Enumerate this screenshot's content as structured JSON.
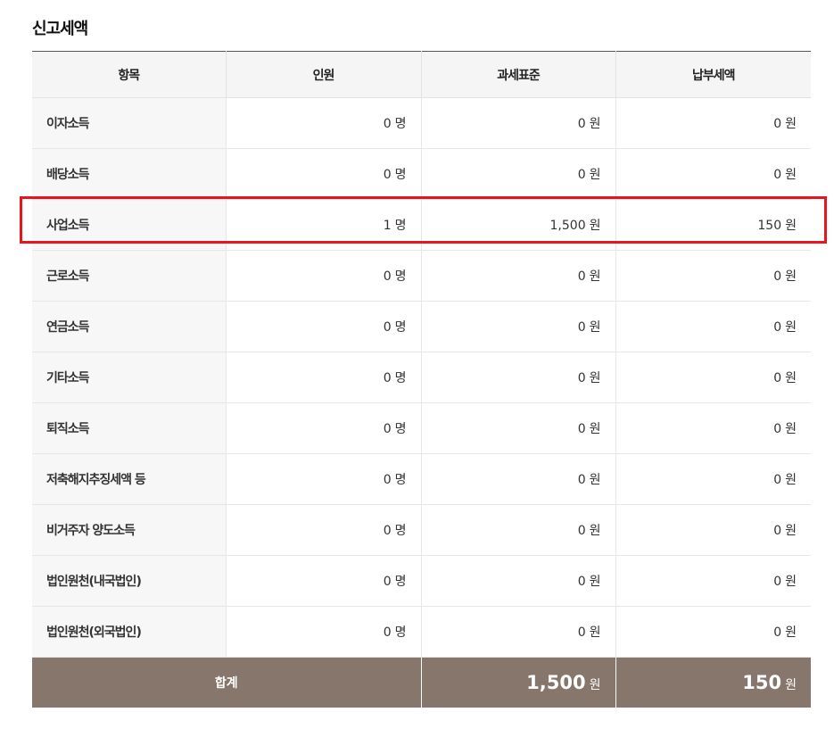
{
  "section_title": "신고세액",
  "headers": {
    "item": "항목",
    "people": "인원",
    "tax_base": "과세표준",
    "tax_paid": "납부세액"
  },
  "rows": [
    {
      "item": "이자소득",
      "people": "0",
      "people_unit": "명",
      "base": "0",
      "base_unit": "원",
      "paid": "0",
      "paid_unit": "원"
    },
    {
      "item": "배당소득",
      "people": "0",
      "people_unit": "명",
      "base": "0",
      "base_unit": "원",
      "paid": "0",
      "paid_unit": "원"
    },
    {
      "item": "사업소득",
      "people": "1",
      "people_unit": "명",
      "base": "1,500",
      "base_unit": "원",
      "paid": "150",
      "paid_unit": "원"
    },
    {
      "item": "근로소득",
      "people": "0",
      "people_unit": "명",
      "base": "0",
      "base_unit": "원",
      "paid": "0",
      "paid_unit": "원"
    },
    {
      "item": "연금소득",
      "people": "0",
      "people_unit": "명",
      "base": "0",
      "base_unit": "원",
      "paid": "0",
      "paid_unit": "원"
    },
    {
      "item": "기타소득",
      "people": "0",
      "people_unit": "명",
      "base": "0",
      "base_unit": "원",
      "paid": "0",
      "paid_unit": "원"
    },
    {
      "item": "퇴직소득",
      "people": "0",
      "people_unit": "명",
      "base": "0",
      "base_unit": "원",
      "paid": "0",
      "paid_unit": "원"
    },
    {
      "item": "저축해지추징세액 등",
      "people": "0",
      "people_unit": "명",
      "base": "0",
      "base_unit": "원",
      "paid": "0",
      "paid_unit": "원"
    },
    {
      "item": "비거주자 양도소득",
      "people": "0",
      "people_unit": "명",
      "base": "0",
      "base_unit": "원",
      "paid": "0",
      "paid_unit": "원"
    },
    {
      "item": "법인원천(내국법인)",
      "people": "0",
      "people_unit": "명",
      "base": "0",
      "base_unit": "원",
      "paid": "0",
      "paid_unit": "원"
    },
    {
      "item": "법인원천(외국법인)",
      "people": "0",
      "people_unit": "명",
      "base": "0",
      "base_unit": "원",
      "paid": "0",
      "paid_unit": "원"
    }
  ],
  "total": {
    "label": "합계",
    "base": "1,500",
    "base_unit": "원",
    "paid": "150",
    "paid_unit": "원"
  },
  "colors": {
    "total_bg": "#87766b",
    "highlight": "#e8151f",
    "header_bg": "#f5f5f5"
  }
}
